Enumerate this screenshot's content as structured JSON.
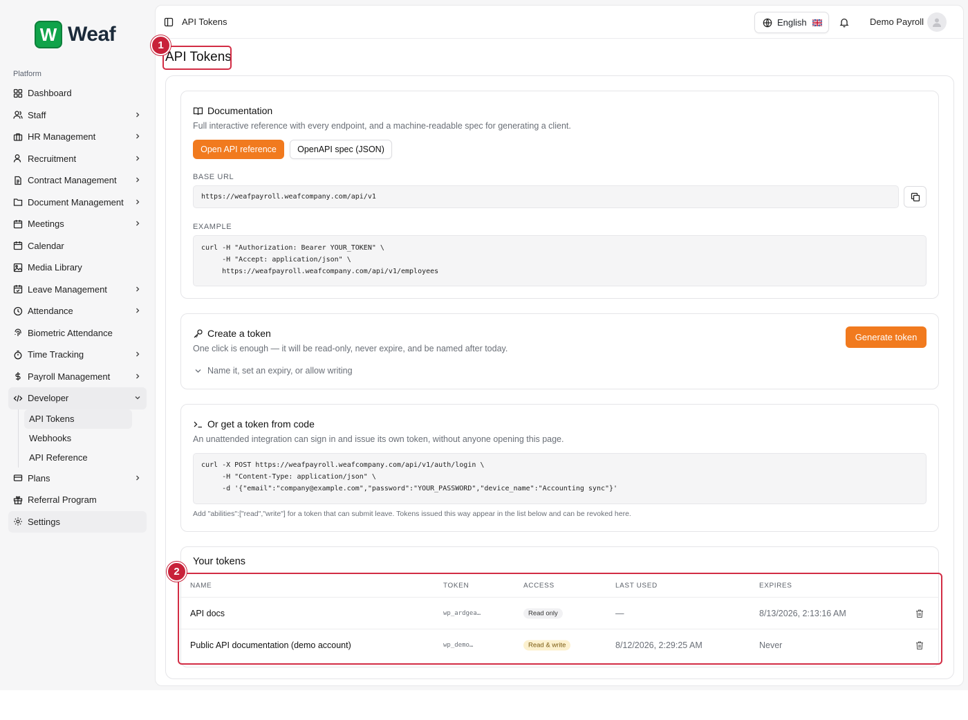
{
  "brand": {
    "logo_letter": "W",
    "name": "Weaf",
    "accent": "#10a34a"
  },
  "sidebar": {
    "section": "Platform",
    "items": [
      {
        "label": "Dashboard",
        "icon": "dashboard-grid-icon",
        "chevron": false
      },
      {
        "label": "Staff",
        "icon": "users-icon",
        "chevron": true
      },
      {
        "label": "HR Management",
        "icon": "briefcase-icon",
        "chevron": true
      },
      {
        "label": "Recruitment",
        "icon": "user-search-icon",
        "chevron": true
      },
      {
        "label": "Contract Management",
        "icon": "file-text-icon",
        "chevron": true
      },
      {
        "label": "Document Management",
        "icon": "folder-icon",
        "chevron": true
      },
      {
        "label": "Meetings",
        "icon": "calendar-clock-icon",
        "chevron": true
      },
      {
        "label": "Calendar",
        "icon": "calendar-icon",
        "chevron": false
      },
      {
        "label": "Media Library",
        "icon": "image-icon",
        "chevron": false
      },
      {
        "label": "Leave Management",
        "icon": "calendar-check-icon",
        "chevron": true
      },
      {
        "label": "Attendance",
        "icon": "clock-icon",
        "chevron": true
      },
      {
        "label": "Biometric Attendance",
        "icon": "fingerprint-icon",
        "chevron": false
      },
      {
        "label": "Time Tracking",
        "icon": "timer-icon",
        "chevron": true
      },
      {
        "label": "Payroll Management",
        "icon": "dollar-icon",
        "chevron": true
      }
    ],
    "developer": {
      "label": "Developer",
      "icon": "code-icon",
      "sub": [
        "API Tokens",
        "Webhooks",
        "API Reference"
      ]
    },
    "after": [
      {
        "label": "Plans",
        "icon": "credit-card-icon",
        "chevron": true
      },
      {
        "label": "Referral Program",
        "icon": "gift-icon",
        "chevron": false
      },
      {
        "label": "Settings",
        "icon": "gear-icon",
        "chevron": false
      }
    ]
  },
  "topbar": {
    "breadcrumb": "API Tokens",
    "language": "English",
    "user": "Demo Payroll"
  },
  "page": {
    "title": "API Tokens",
    "markers": [
      "1",
      "2"
    ]
  },
  "docs": {
    "title": "Documentation",
    "subtitle": "Full interactive reference with every endpoint, and a machine-readable spec for generating a client.",
    "primary_button": "Open API reference",
    "secondary_button": "OpenAPI spec (JSON)",
    "base_url_label": "BASE URL",
    "base_url": "https://weafpayroll.weafcompany.com/api/v1",
    "example_label": "EXAMPLE",
    "example_lines": [
      "curl -H \"Authorization: Bearer YOUR_TOKEN\" \\",
      "     -H \"Accept: application/json\" \\",
      "     https://weafpayroll.weafcompany.com/api/v1/employees"
    ]
  },
  "create": {
    "title": "Create a token",
    "subtitle": "One click is enough — it will be read-only, never expire, and be named after today.",
    "button": "Generate token",
    "disclosure": "Name it, set an expiry, or allow writing"
  },
  "code": {
    "title": "Or get a token from code",
    "subtitle": "An unattended integration can sign in and issue its own token, without anyone opening this page.",
    "lines": [
      "curl -X POST https://weafpayroll.weafcompany.com/api/v1/auth/login \\",
      "     -H \"Content-Type: application/json\" \\",
      "     -d '{\"email\":\"company@example.com\",\"password\":\"YOUR_PASSWORD\",\"device_name\":\"Accounting sync\"}'"
    ],
    "hint": "Add \"abilities\":[\"read\",\"write\"] for a token that can submit leave. Tokens issued this way appear in the list below and can be revoked here."
  },
  "tokens": {
    "title": "Your tokens",
    "columns": [
      "NAME",
      "TOKEN",
      "ACCESS",
      "LAST USED",
      "EXPIRES"
    ],
    "rows": [
      {
        "name": "API docs",
        "token": "wp_ardgea…",
        "access": "Read only",
        "last_used": "—",
        "expires": "8/13/2026, 2:13:16 AM"
      },
      {
        "name": "Public API documentation (demo account)",
        "token": "wp_demo…",
        "access": "Read & write",
        "last_used": "8/12/2026, 2:29:25 AM",
        "expires": "Never"
      }
    ]
  },
  "colors": {
    "orange": "#f17a1e",
    "highlight_red": "#d22c44"
  }
}
